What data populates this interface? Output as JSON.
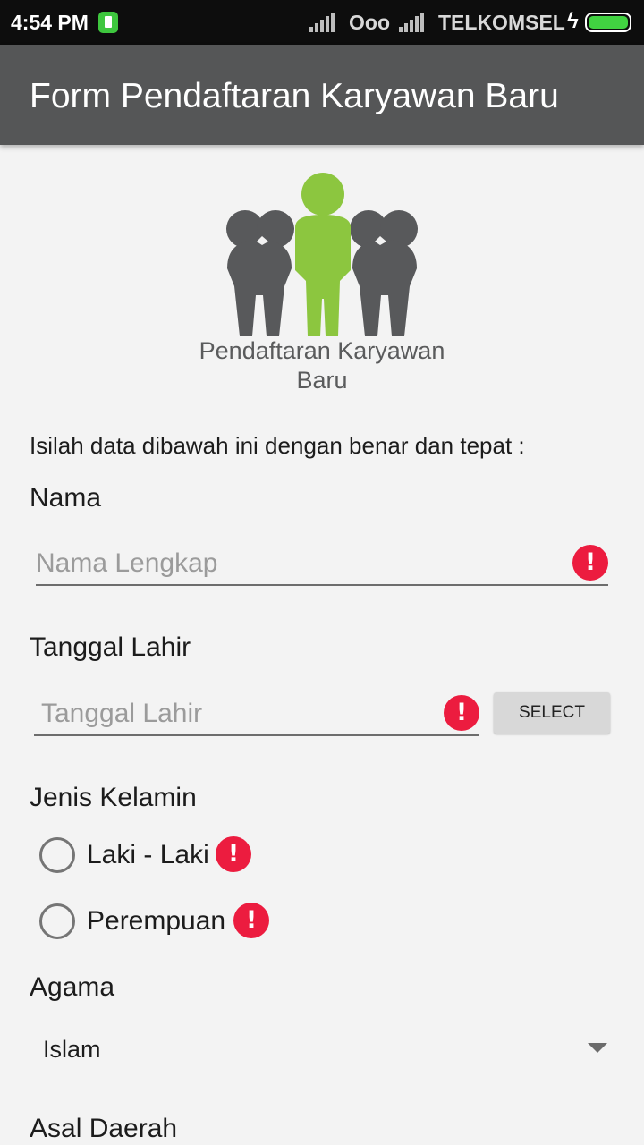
{
  "status_bar": {
    "time": "4:54 PM",
    "carrier_1": "Ooo",
    "carrier_2": "TELKOMSEL",
    "icons": [
      "battery-saver-icon",
      "signal-icon",
      "signal-icon",
      "charging-icon",
      "battery-icon"
    ]
  },
  "action_bar": {
    "title": "Form Pendaftaran Karyawan Baru"
  },
  "logo": {
    "caption_line1": "Pendaftaran Karyawan",
    "caption_line2": "Baru",
    "colors": {
      "accent": "#8cc63f",
      "figures": "#58595b"
    }
  },
  "form": {
    "intro": "Isilah data dibawah ini dengan benar dan tepat :",
    "nama": {
      "label": "Nama",
      "placeholder": "Nama Lengkap",
      "value": "",
      "error": true
    },
    "tanggal_lahir": {
      "label": "Tanggal Lahir",
      "placeholder": "Tanggal Lahir",
      "value": "",
      "error": true,
      "button": "SELECT"
    },
    "jenis_kelamin": {
      "label": "Jenis Kelamin",
      "options": [
        {
          "label": "Laki - Laki",
          "checked": false,
          "error": true
        },
        {
          "label": "Perempuan",
          "checked": false,
          "error": true
        }
      ]
    },
    "agama": {
      "label": "Agama",
      "selected": "Islam"
    },
    "asal_daerah": {
      "label": "Asal Daerah"
    }
  },
  "colors": {
    "error": "#ec1c3f",
    "toolbar": "#555657",
    "background": "#f3f3f3"
  }
}
